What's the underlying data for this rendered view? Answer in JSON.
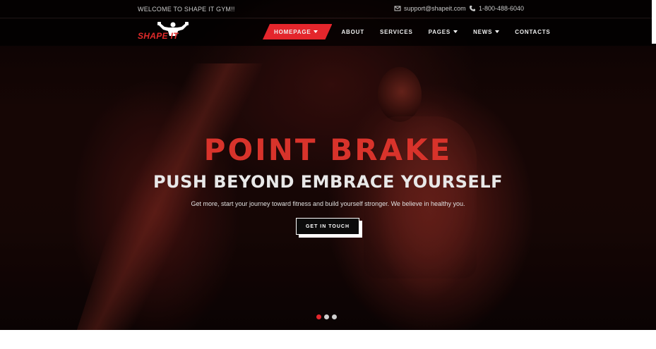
{
  "topbar": {
    "welcome": "WELCOME TO SHAPE IT GYM!!",
    "email": "support@shapeit.com",
    "phone": "1-800-488-6040",
    "email_icon": "envelope-icon",
    "phone_icon": "phone-icon"
  },
  "header": {
    "logo_text": "SHAPE IT",
    "nav": [
      {
        "label": "HOMEPAGE",
        "active": true,
        "dropdown": true
      },
      {
        "label": "ABOUT",
        "active": false,
        "dropdown": false
      },
      {
        "label": "SERVICES",
        "active": false,
        "dropdown": false
      },
      {
        "label": "PAGES",
        "active": false,
        "dropdown": true
      },
      {
        "label": "NEWS",
        "active": false,
        "dropdown": true
      },
      {
        "label": "CONTACTS",
        "active": false,
        "dropdown": false
      }
    ]
  },
  "hero": {
    "title": "POINT BRAKE",
    "subtitle": "PUSH BEYOND EMBRACE YOURSELF",
    "description": "Get more, start your journey toward fitness and build yourself stronger. We believe in healthy you.",
    "cta_label": "GET IN TOUCH",
    "slides": 3,
    "active_slide": 1
  },
  "colors": {
    "accent": "#e4262c",
    "title_red": "#d8332b",
    "topbar_bg": "#000000"
  }
}
